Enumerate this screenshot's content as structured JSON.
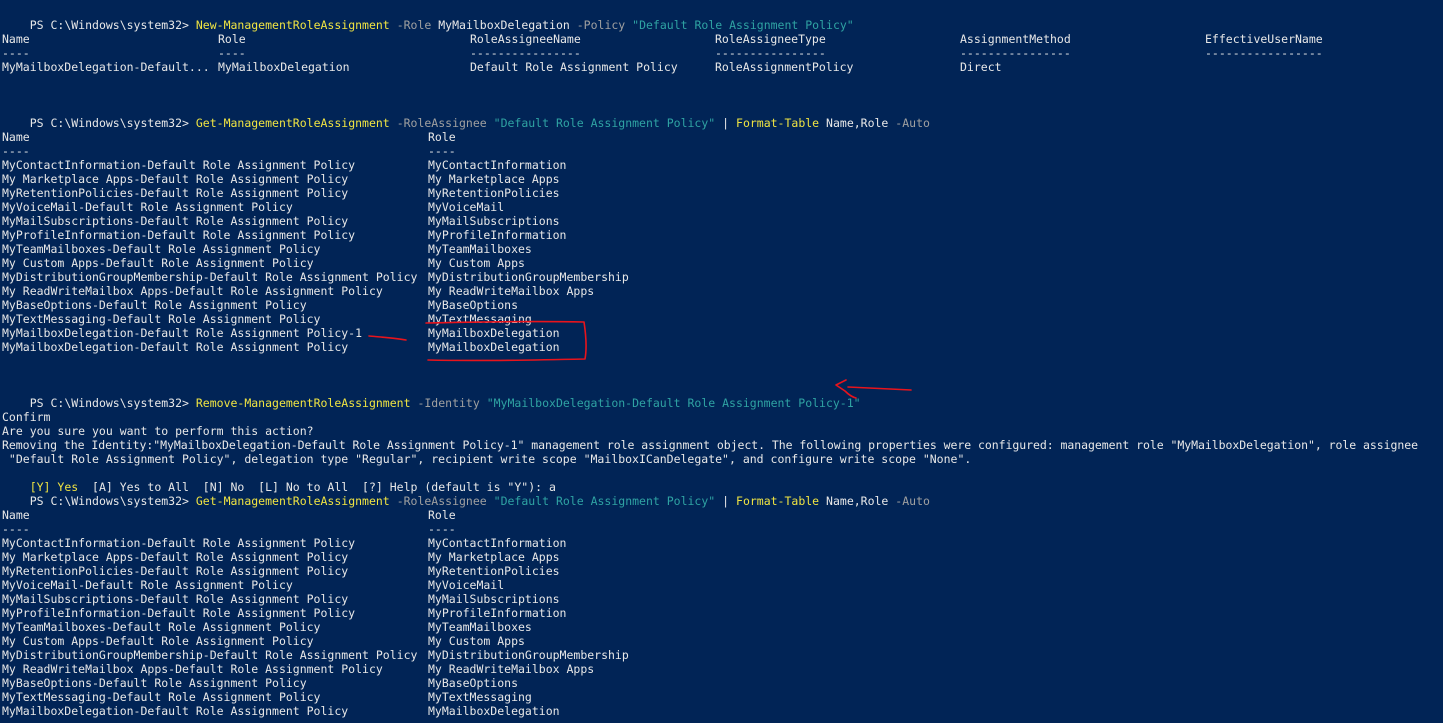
{
  "prompt": "PS C:\\Windows\\system32> ",
  "block1": {
    "command": "New-ManagementRoleAssignment",
    "p1": "-Role",
    "p1_value": "MyMailboxDelegation",
    "p2": "-Policy",
    "p2_value": "\"Default Role Assignment Policy\"",
    "headers": [
      "Name",
      "Role",
      "RoleAssigneeName",
      "RoleAssigneeType",
      "AssignmentMethod",
      "EffectiveUserName"
    ],
    "separators": [
      "----",
      "----",
      "----------------",
      "----------------",
      "----------------",
      "-----------------"
    ],
    "row": [
      "MyMailboxDelegation-Default...",
      "MyMailboxDelegation",
      "Default Role Assignment Policy",
      "RoleAssignmentPolicy",
      "Direct",
      ""
    ]
  },
  "block2": {
    "command": "Get-ManagementRoleAssignment",
    "p1": "-RoleAssignee",
    "p1_value": "\"Default Role Assignment Policy\"",
    "pipe": "|",
    "format_cmd": "Format-Table",
    "format_args": "Name,Role",
    "format_param": "-Auto",
    "headers": [
      "Name",
      "Role"
    ],
    "separators": [
      "----",
      "----"
    ],
    "rows": [
      [
        "MyContactInformation-Default Role Assignment Policy",
        "MyContactInformation"
      ],
      [
        "My Marketplace Apps-Default Role Assignment Policy",
        "My Marketplace Apps"
      ],
      [
        "MyRetentionPolicies-Default Role Assignment Policy",
        "MyRetentionPolicies"
      ],
      [
        "MyVoiceMail-Default Role Assignment Policy",
        "MyVoiceMail"
      ],
      [
        "MyMailSubscriptions-Default Role Assignment Policy",
        "MyMailSubscriptions"
      ],
      [
        "MyProfileInformation-Default Role Assignment Policy",
        "MyProfileInformation"
      ],
      [
        "MyTeamMailboxes-Default Role Assignment Policy",
        "MyTeamMailboxes"
      ],
      [
        "My Custom Apps-Default Role Assignment Policy",
        "My Custom Apps"
      ],
      [
        "MyDistributionGroupMembership-Default Role Assignment Policy",
        "MyDistributionGroupMembership"
      ],
      [
        "My ReadWriteMailbox Apps-Default Role Assignment Policy",
        "My ReadWriteMailbox Apps"
      ],
      [
        "MyBaseOptions-Default Role Assignment Policy",
        "MyBaseOptions"
      ],
      [
        "MyTextMessaging-Default Role Assignment Policy",
        "MyTextMessaging"
      ],
      [
        "MyMailboxDelegation-Default Role Assignment Policy-1",
        "MyMailboxDelegation"
      ],
      [
        "MyMailboxDelegation-Default Role Assignment Policy",
        "MyMailboxDelegation"
      ]
    ]
  },
  "block3": {
    "command": "Remove-ManagementRoleAssignment",
    "p1": "-Identity",
    "p1_value": "\"MyMailboxDelegation-Default Role Assignment Policy-1\"",
    "confirm_title": "Confirm",
    "confirm_question": "Are you sure you want to perform this action?",
    "confirm_detail_1": "Removing the Identity:\"MyMailboxDelegation-Default Role Assignment Policy-1\" management role assignment object. The following properties were configured: management role \"MyMailboxDelegation\", role assignee",
    "confirm_detail_2": " \"Default Role Assignment Policy\", delegation type \"Regular\", recipient write scope \"MailboxICanDelegate\", and configure write scope \"None\".",
    "choice_yes": "[Y] Yes",
    "choices_rest": "  [A] Yes to All  [N] No  [L] No to All  [?] Help (default is \"Y\"): a"
  },
  "block4": {
    "command": "Get-ManagementRoleAssignment",
    "p1": "-RoleAssignee",
    "p1_value": "\"Default Role Assignment Policy\"",
    "pipe": "|",
    "format_cmd": "Format-Table",
    "format_args": "Name,Role",
    "format_param": "-Auto",
    "headers": [
      "Name",
      "Role"
    ],
    "separators": [
      "----",
      "----"
    ],
    "rows": [
      [
        "MyContactInformation-Default Role Assignment Policy",
        "MyContactInformation"
      ],
      [
        "My Marketplace Apps-Default Role Assignment Policy",
        "My Marketplace Apps"
      ],
      [
        "MyRetentionPolicies-Default Role Assignment Policy",
        "MyRetentionPolicies"
      ],
      [
        "MyVoiceMail-Default Role Assignment Policy",
        "MyVoiceMail"
      ],
      [
        "MyMailSubscriptions-Default Role Assignment Policy",
        "MyMailSubscriptions"
      ],
      [
        "MyProfileInformation-Default Role Assignment Policy",
        "MyProfileInformation"
      ],
      [
        "MyTeamMailboxes-Default Role Assignment Policy",
        "MyTeamMailboxes"
      ],
      [
        "My Custom Apps-Default Role Assignment Policy",
        "My Custom Apps"
      ],
      [
        "MyDistributionGroupMembership-Default Role Assignment Policy",
        "MyDistributionGroupMembership"
      ],
      [
        "My ReadWriteMailbox Apps-Default Role Assignment Policy",
        "My ReadWriteMailbox Apps"
      ],
      [
        "MyBaseOptions-Default Role Assignment Policy",
        "MyBaseOptions"
      ],
      [
        "MyTextMessaging-Default Role Assignment Policy",
        "MyTextMessaging"
      ],
      [
        "MyMailboxDelegation-Default Role Assignment Policy",
        "MyMailboxDelegation"
      ]
    ]
  },
  "colors": {
    "background": "#012456",
    "text": "#e8e8e8",
    "command": "#f0e442",
    "parameter": "#a0a0a0",
    "string": "#2fa3a3",
    "annotation": "#e8141c"
  },
  "annotations": [
    "underline-red",
    "rectangle-red",
    "arrow-red"
  ]
}
